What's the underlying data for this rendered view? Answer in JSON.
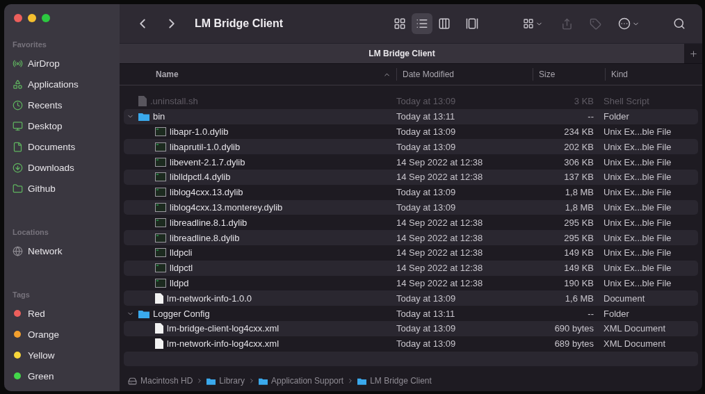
{
  "window": {
    "title": "LM Bridge Client"
  },
  "sidebar": {
    "sections": [
      {
        "heading": "Favorites",
        "items": [
          {
            "label": "AirDrop",
            "kind": "airdrop"
          },
          {
            "label": "Applications",
            "kind": "apps"
          },
          {
            "label": "Recents",
            "kind": "clock"
          },
          {
            "label": "Desktop",
            "kind": "desktop"
          },
          {
            "label": "Documents",
            "kind": "doc"
          },
          {
            "label": "Downloads",
            "kind": "download"
          },
          {
            "label": "Github",
            "kind": "folder"
          }
        ]
      },
      {
        "heading": "Locations",
        "items": [
          {
            "label": "Network",
            "kind": "network"
          }
        ]
      },
      {
        "heading": "Tags",
        "items": [
          {
            "label": "Red",
            "kind": "tag",
            "color": "#ec5f5c"
          },
          {
            "label": "Orange",
            "kind": "tag",
            "color": "#f3a02e"
          },
          {
            "label": "Yellow",
            "kind": "tag",
            "color": "#f7d63a"
          },
          {
            "label": "Green",
            "kind": "tag",
            "color": "#43d64a"
          }
        ]
      }
    ]
  },
  "toolbar": {
    "views": [
      {
        "kind": "icons",
        "selected": false
      },
      {
        "kind": "list",
        "selected": true
      },
      {
        "kind": "columns",
        "selected": false
      },
      {
        "kind": "gallery",
        "selected": false
      }
    ],
    "share_disabled": true,
    "tags_disabled": true
  },
  "tabs": [
    {
      "label": "LM Bridge Client",
      "selected": true
    }
  ],
  "table": {
    "columns": [
      "Name",
      "Date Modified",
      "Size",
      "Kind"
    ],
    "rows": [
      {
        "name": ".uninstall.sh",
        "date": "Today at 13:09",
        "size": "3 KB",
        "kind_text": "Shell Script",
        "kind": "script",
        "hidden": true
      },
      {
        "name": "bin",
        "date": "Today at 13:11",
        "size": "--",
        "kind_text": "Folder",
        "kind": "folder",
        "expanded": true,
        "children": [
          {
            "name": "libapr-1.0.dylib",
            "date": "Today at 13:09",
            "size": "234 KB",
            "kind_text": "Unix Ex...ble File",
            "kind": "exec"
          },
          {
            "name": "libaprutil-1.0.dylib",
            "date": "Today at 13:09",
            "size": "202 KB",
            "kind_text": "Unix Ex...ble File",
            "kind": "exec"
          },
          {
            "name": "libevent-2.1.7.dylib",
            "date": "14 Sep 2022 at 12:38",
            "size": "306 KB",
            "kind_text": "Unix Ex...ble File",
            "kind": "exec"
          },
          {
            "name": "liblldpctl.4.dylib",
            "date": "14 Sep 2022 at 12:38",
            "size": "137 KB",
            "kind_text": "Unix Ex...ble File",
            "kind": "exec"
          },
          {
            "name": "liblog4cxx.13.dylib",
            "date": "Today at 13:09",
            "size": "1,8 MB",
            "kind_text": "Unix Ex...ble File",
            "kind": "exec"
          },
          {
            "name": "liblog4cxx.13.monterey.dylib",
            "date": "Today at 13:09",
            "size": "1,8 MB",
            "kind_text": "Unix Ex...ble File",
            "kind": "exec"
          },
          {
            "name": "libreadline.8.1.dylib",
            "date": "14 Sep 2022 at 12:38",
            "size": "295 KB",
            "kind_text": "Unix Ex...ble File",
            "kind": "exec"
          },
          {
            "name": "libreadline.8.dylib",
            "date": "14 Sep 2022 at 12:38",
            "size": "295 KB",
            "kind_text": "Unix Ex...ble File",
            "kind": "exec"
          },
          {
            "name": "lldpcli",
            "date": "14 Sep 2022 at 12:38",
            "size": "149 KB",
            "kind_text": "Unix Ex...ble File",
            "kind": "exec"
          },
          {
            "name": "lldpctl",
            "date": "14 Sep 2022 at 12:38",
            "size": "149 KB",
            "kind_text": "Unix Ex...ble File",
            "kind": "exec"
          },
          {
            "name": "lldpd",
            "date": "14 Sep 2022 at 12:38",
            "size": "190 KB",
            "kind_text": "Unix Ex...ble File",
            "kind": "exec"
          },
          {
            "name": "lm-network-info-1.0.0",
            "date": "Today at 13:09",
            "size": "1,6 MB",
            "kind_text": "Document",
            "kind": "document"
          }
        ]
      },
      {
        "name": "Logger Config",
        "date": "Today at 13:11",
        "size": "--",
        "kind_text": "Folder",
        "kind": "folder",
        "expanded": true,
        "children": [
          {
            "name": "lm-bridge-client-log4cxx.xml",
            "date": "Today at 13:09",
            "size": "690 bytes",
            "kind_text": "XML Document",
            "kind": "xml"
          },
          {
            "name": "lm-network-info-log4cxx.xml",
            "date": "Today at 13:09",
            "size": "689 bytes",
            "kind_text": "XML Document",
            "kind": "xml"
          }
        ]
      }
    ]
  },
  "path_bar": [
    {
      "label": "Macintosh HD",
      "kind": "disk"
    },
    {
      "label": "Library",
      "kind": "folder"
    },
    {
      "label": "Application Support",
      "kind": "folder"
    },
    {
      "label": "LM Bridge Client",
      "kind": "folder"
    }
  ]
}
